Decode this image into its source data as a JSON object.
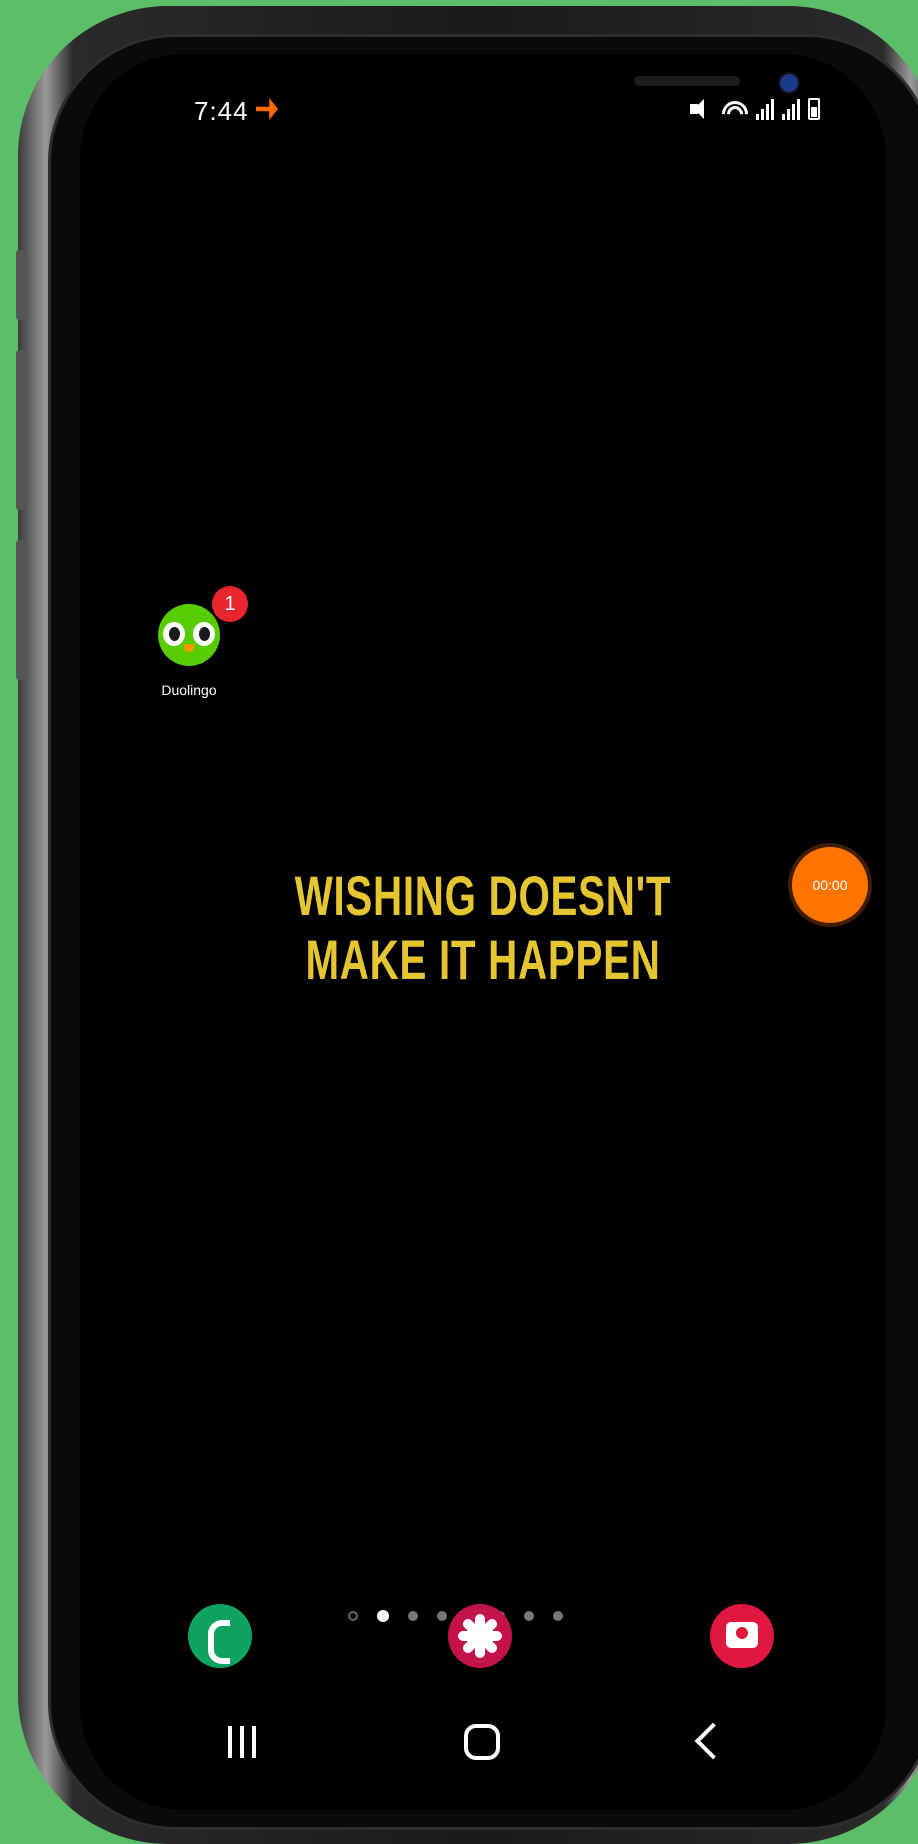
{
  "status_bar": {
    "time": "7:44",
    "icons": [
      "notification-icon",
      "mute-icon",
      "wifi-icon",
      "signal-icon",
      "signal-icon",
      "battery-icon"
    ]
  },
  "home_screen": {
    "apps": [
      {
        "label": "Duolingo",
        "badge": "1",
        "icon": "duolingo-icon"
      }
    ],
    "wallpaper_quote": {
      "line1": "WISHING DOESN'T",
      "line2": "MAKE IT HAPPEN",
      "color": "#e6c630"
    },
    "floating_timer": {
      "value": "00:00",
      "color": "#ff7300"
    },
    "page_indicator": {
      "pages": 8,
      "active_index": 0
    }
  },
  "dock": [
    {
      "name": "phone",
      "icon": "phone-icon",
      "color": "#0da35e"
    },
    {
      "name": "gallery",
      "icon": "gallery-icon",
      "color": "#c4124a"
    },
    {
      "name": "camera",
      "icon": "camera-icon",
      "color": "#e0173f"
    }
  ],
  "nav_bar": {
    "buttons": [
      "recent-apps-icon",
      "home-icon",
      "back-icon"
    ]
  },
  "colors": {
    "background": "#5bbf6a",
    "screen": "#000000"
  }
}
